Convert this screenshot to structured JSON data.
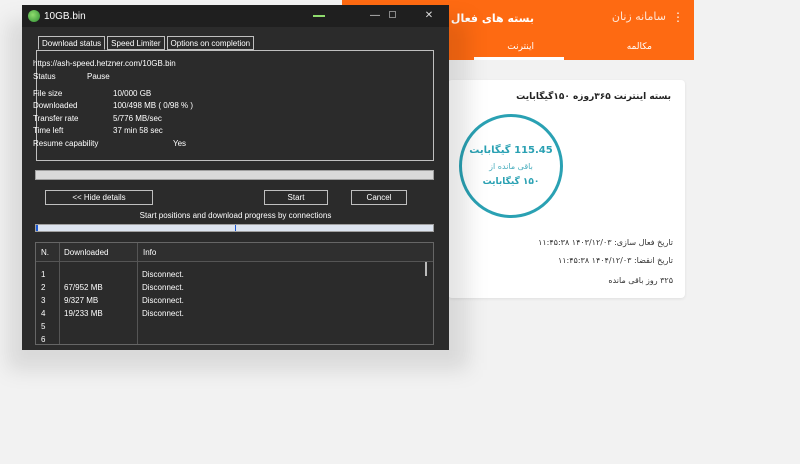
{
  "web_app": {
    "header_title": "بسته های فعال",
    "logo_text": "سامانه زنان",
    "tabs": {
      "internet": "اینترنت",
      "call": "مکالمه"
    },
    "card": {
      "package_name": "بسته اینترنت ۳۶۵روزه ۱۵۰گیگابایت",
      "remaining_value": "115.45 گیگابایت",
      "remaining_label": "باقی مانده از",
      "total_value": "۱۵۰ گیگابایت",
      "activation_date": "تاریخ فعال سازی: ۱۴۰۳/۱۲/۰۳ ۱۱:۴۵:۳۸",
      "expiry_date": "تاریخ انقضا: ۱۴۰۴/۱۲/۰۳ ۱۱:۴۵:۳۸",
      "days_left": "۳۲۵ روز باقی مانده"
    },
    "accent_color": "#fe6a12",
    "ring_color": "#2aa1b3"
  },
  "dialog": {
    "title": "10GB.bin",
    "tabs": [
      "Download status",
      "Speed Limiter",
      "Options on completion"
    ],
    "url": "https://ash-speed.hetzner.com/10GB.bin",
    "fields": {
      "status": {
        "label": "Status",
        "value": "Pause"
      },
      "file_size": {
        "label": "File size",
        "value": "10/000  GB"
      },
      "downloaded": {
        "label": "Downloaded",
        "value": "100/498  MB  ( 0/98 % )"
      },
      "transfer_rate": {
        "label": "Transfer rate",
        "value": "5/776  MB/sec"
      },
      "time_left": {
        "label": "Time left",
        "value": "37 min 58 sec"
      },
      "resume": {
        "label": "Resume capability",
        "value": "Yes"
      }
    },
    "progress_fraction": 0.0098,
    "buttons": {
      "hide_details": "<< Hide details",
      "start": "Start",
      "cancel": "Cancel"
    },
    "connections_label": "Start positions and download progress by connections",
    "table": {
      "headers": {
        "n": "N.",
        "downloaded": "Downloaded",
        "info": "Info"
      },
      "rows": [
        {
          "n": "1",
          "downloaded": "",
          "info": "Disconnect."
        },
        {
          "n": "2",
          "downloaded": "67/952  MB",
          "info": "Disconnect."
        },
        {
          "n": "3",
          "downloaded": "9/327  MB",
          "info": "Disconnect."
        },
        {
          "n": "4",
          "downloaded": "19/233  MB",
          "info": "Disconnect."
        },
        {
          "n": "5",
          "downloaded": "",
          "info": ""
        },
        {
          "n": "6",
          "downloaded": "",
          "info": ""
        }
      ]
    }
  }
}
